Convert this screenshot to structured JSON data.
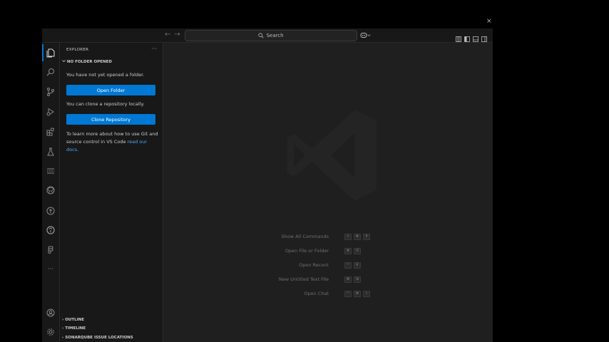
{
  "desktop": {
    "close_glyph": "×"
  },
  "titlebar": {
    "back_glyph": "←",
    "forward_glyph": "→",
    "search_label": "Search"
  },
  "activity_bar": {
    "icons": [
      "files-icon",
      "search-icon",
      "source-control-icon",
      "run-debug-icon",
      "extensions-icon",
      "testing-icon",
      "timeline-icon",
      "github-icon",
      "gitlens-icon",
      "copilot-icon",
      "figma-icon",
      "more-icon",
      "account-icon",
      "settings-gear-icon"
    ]
  },
  "sidebar": {
    "title": "EXPLORER",
    "more_glyph": "···",
    "section_title": "NO FOLDER OPENED",
    "no_folder_text": "You have not yet opened a folder.",
    "open_folder_button": "Open Folder",
    "clone_text": "You can clone a repository locally.",
    "clone_button": "Clone Repository",
    "learn_text_1": "To learn more about how to use Git and",
    "learn_text_2": "source control in VS Code ",
    "learn_link": "read our docs",
    "learn_text_end": ".",
    "panels": [
      "OUTLINE",
      "TIMELINE",
      "SONARQUBE ISSUE LOCATIONS"
    ]
  },
  "editor": {
    "shortcuts": [
      {
        "label": "Show All Commands",
        "keys": [
          "⇧",
          "⌘",
          "P"
        ]
      },
      {
        "label": "Open File or Folder",
        "keys": [
          "⌘",
          "O"
        ]
      },
      {
        "label": "Open Recent",
        "keys": [
          "^",
          "R"
        ]
      },
      {
        "label": "New Untitled Text File",
        "keys": [
          "⌘",
          "N"
        ]
      },
      {
        "label": "Open Chat",
        "keys": [
          "^",
          "⌘",
          "I"
        ]
      }
    ]
  },
  "colors": {
    "accent": "#0078d4",
    "link": "#4daafc",
    "background": "#181818",
    "editor": "#1f1f1f"
  }
}
